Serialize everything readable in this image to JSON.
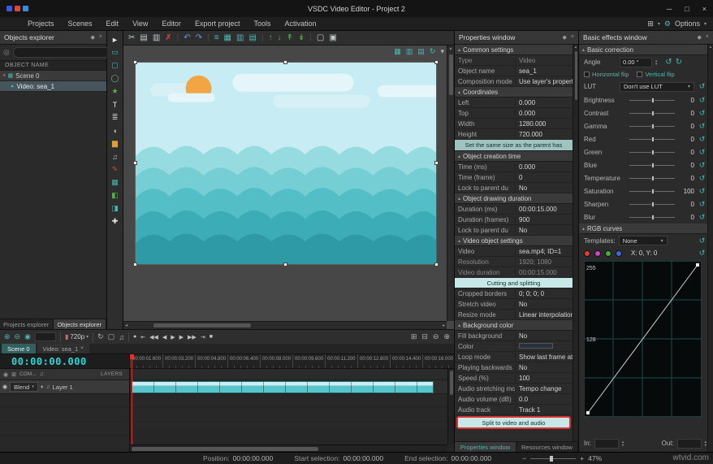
{
  "colors": {
    "accent": "#4db6b0",
    "timecode_cyan": "#2fd8d8",
    "annotation_red": "#e03030"
  },
  "icons": {
    "pin": "◆",
    "close": "×",
    "caret_up": "▴",
    "caret_down": "▾",
    "caret_right": "▸",
    "caret_left": "◂",
    "search": "◎",
    "eye": "◉",
    "lock": "⊠",
    "speaker": "♫",
    "diamond": "♦",
    "reset": "↺",
    "rotate_ccw": "↺",
    "rotate_cw": "↻",
    "menu": "≡",
    "window_min": "─",
    "window_max": "□",
    "grid": "⊞",
    "gear": "⚙",
    "minus": "−",
    "plus": "+",
    "quality_film": "▮"
  },
  "titlebar": {
    "title": "VSDC Video Editor - Project 2",
    "logo_colors": [
      "#3b5bd6",
      "#d64a3b",
      "#3b8bd6"
    ]
  },
  "menubar": {
    "items": [
      "Projects",
      "Scenes",
      "Edit",
      "View",
      "Editor",
      "Export project",
      "Tools",
      "Activation"
    ],
    "options": "Options"
  },
  "toolbar": {
    "icons": [
      {
        "name": "cut-icon",
        "glyph": "✂",
        "color": "#c2cccc"
      },
      {
        "name": "copy-icon",
        "glyph": "▤",
        "color": "#c2cccc"
      },
      {
        "name": "paste-icon",
        "glyph": "▥",
        "color": "#c2cccc"
      },
      {
        "name": "delete-icon",
        "glyph": "✗",
        "color": "#d24a43"
      },
      {
        "name": "separator",
        "glyph": "|",
        "color": "#4a4a4a"
      },
      {
        "name": "undo-icon",
        "glyph": "↶",
        "color": "#5f9fd8"
      },
      {
        "name": "redo-icon",
        "glyph": "↷",
        "color": "#5f9fd8"
      },
      {
        "name": "separator",
        "glyph": "|",
        "color": "#4a4a4a"
      },
      {
        "name": "align-list-icon",
        "glyph": "≡",
        "color": "#4db6b0"
      },
      {
        "name": "align-grid-icon",
        "glyph": "▦",
        "color": "#4db6b0"
      },
      {
        "name": "align-columns-icon",
        "glyph": "▥",
        "color": "#4db6b0"
      },
      {
        "name": "align-rows-icon",
        "glyph": "▤",
        "color": "#4db6b0"
      },
      {
        "name": "separator",
        "glyph": "|",
        "color": "#4a4a4a"
      },
      {
        "name": "move-up-icon",
        "glyph": "↑",
        "color": "#58b04e"
      },
      {
        "name": "move-down-icon",
        "glyph": "↓",
        "color": "#58b04e"
      },
      {
        "name": "move-top-icon",
        "glyph": "↟",
        "color": "#58b04e"
      },
      {
        "name": "move-bottom-icon",
        "glyph": "↡",
        "color": "#58b04e"
      },
      {
        "name": "separator",
        "glyph": "|",
        "color": "#4a4a4a"
      },
      {
        "name": "group-icon",
        "glyph": "▢",
        "color": "#c2cccc"
      },
      {
        "name": "ungroup-icon",
        "glyph": "▣",
        "color": "#c2cccc"
      }
    ]
  },
  "preview_corner": {
    "icons": [
      {
        "name": "grid-view-icon",
        "glyph": "▦",
        "color": "#4db6b0"
      },
      {
        "name": "split-view-icon",
        "glyph": "▥",
        "color": "#4db6b0"
      },
      {
        "name": "layout-view-icon",
        "glyph": "▤",
        "color": "#4db6b0"
      },
      {
        "name": "refresh-view-icon",
        "glyph": "↻",
        "color": "#4db6b0"
      },
      {
        "name": "view-menu-icon",
        "glyph": "▾",
        "color": "#b0b0b0"
      }
    ]
  },
  "tools": {
    "icons": [
      {
        "name": "cursor-tool-icon",
        "glyph": "►",
        "color": "#e8e8e8"
      },
      {
        "name": "select-tool-icon",
        "glyph": "▭",
        "color": "#4db6b0"
      },
      {
        "name": "rectangle-tool-icon",
        "glyph": "▢",
        "color": "#4db6b0"
      },
      {
        "name": "ellipse-tool-icon",
        "glyph": "◯",
        "color": "#4db6b0"
      },
      {
        "name": "star-tool-icon",
        "glyph": "★",
        "color": "#58b04e"
      },
      {
        "name": "text-tool-icon",
        "glyph": "T",
        "color": "#e8e8e8"
      },
      {
        "name": "lines-tool-icon",
        "glyph": "≣",
        "color": "#c0c0c0"
      },
      {
        "name": "tooltip-tool-icon",
        "glyph": "◖",
        "color": "#c0c0c0"
      },
      {
        "name": "chart-tool-icon",
        "glyph": "▆",
        "color": "#d8a13c"
      },
      {
        "name": "audio-tool-icon",
        "glyph": "♫",
        "color": "#c0c0c0"
      },
      {
        "name": "pencil-tool-icon",
        "glyph": "✎",
        "color": "#d24a43"
      },
      {
        "name": "sprite-tool-icon",
        "glyph": "▦",
        "color": "#4db6b0"
      },
      {
        "name": "animation-tool-icon",
        "glyph": "◧",
        "color": "#58b04e"
      },
      {
        "name": "gradient-tool-icon",
        "glyph": "◨",
        "color": "#4db6b0"
      },
      {
        "name": "movement-tool-icon",
        "glyph": "✚",
        "color": "#e8e8e8"
      }
    ]
  },
  "objects_explorer": {
    "title": "Objects explorer",
    "column_header": "OBJECT NAME",
    "scene_label": "Scene 0",
    "video_label": "Video: sea_1",
    "tabs": {
      "projects": "Projects explorer",
      "objects": "Objects explorer"
    }
  },
  "preview": {
    "canvas": {
      "sky": "#c8ecf3",
      "cloud": "#e4f6f9",
      "cloud2": "#d6f0f6",
      "sun": "#f2a643",
      "waves": [
        "#96dbdf",
        "#74ced4",
        "#54bec7",
        "#3cacb7",
        "#2d9aa6"
      ]
    }
  },
  "transport": {
    "left": [
      {
        "name": "add-object-icon",
        "glyph": "⊕",
        "color": "#4db6b0"
      },
      {
        "name": "remove-object-icon",
        "glyph": "⊖",
        "color": "#4db6b0"
      },
      {
        "name": "capture-icon",
        "glyph": "◉",
        "color": "#4db6b0"
      }
    ],
    "quality": "720p",
    "mid": [
      {
        "name": "loop-playback-icon",
        "glyph": "↻",
        "color": "#b0b0b0"
      },
      {
        "name": "preview-window-icon",
        "glyph": "▢",
        "color": "#b0b0b0"
      },
      {
        "name": "audio-mute-icon",
        "glyph": "♫",
        "color": "#b0b0b0"
      }
    ],
    "buttons": [
      {
        "name": "record-icon",
        "glyph": "●",
        "color": "#c0c0c0"
      },
      {
        "name": "go-start-icon",
        "glyph": "⇤",
        "color": "#c0c0c0"
      },
      {
        "name": "fast-backward-icon",
        "glyph": "◀◀",
        "color": "#c0c0c0"
      },
      {
        "name": "frame-back-icon",
        "glyph": "◀",
        "color": "#c0c0c0"
      },
      {
        "name": "play-icon",
        "glyph": "▶",
        "color": "#c0c0c0"
      },
      {
        "name": "frame-forward-icon",
        "glyph": "▶",
        "color": "#c0c0c0"
      },
      {
        "name": "fast-forward-icon",
        "glyph": "▶▶",
        "color": "#c0c0c0"
      },
      {
        "name": "go-end-icon",
        "glyph": "⇥",
        "color": "#c0c0c0"
      },
      {
        "name": "stop-icon",
        "glyph": "■",
        "color": "#c0c0c0"
      }
    ],
    "right": [
      {
        "name": "fit-timeline-icon",
        "glyph": "⊞",
        "color": "#b0b0b0"
      },
      {
        "name": "zoom-selection-icon",
        "glyph": "⊟",
        "color": "#b0b0b0"
      },
      {
        "name": "timeline-zoom-out-icon",
        "glyph": "⊖",
        "color": "#b0b0b0"
      },
      {
        "name": "timeline-zoom-in-icon",
        "glyph": "⊕",
        "color": "#b0b0b0"
      }
    ]
  },
  "scene_tabs": {
    "scene": "Scene 0",
    "video": "Video: sea_1"
  },
  "timeline": {
    "timecode": "00:00:00.000",
    "com_label": "COM...",
    "layers_label": "LAYERS",
    "blend_label": "Blend",
    "layer_label": "Layer 1",
    "ruler": [
      "00:00:01.600",
      "00:00:03.200",
      "00:00:04.800",
      "00:00:06.400",
      "00:00:08.000",
      "00:00:09.600",
      "00:00:11.200",
      "00:00:12.800",
      "00:00:14.400",
      "00:00:16.000"
    ]
  },
  "properties": {
    "title": "Properties window",
    "sections": {
      "common": {
        "header": "Common settings",
        "rows": [
          {
            "label": "Type",
            "value": "Video",
            "lcolor": "#8a8a8a",
            "vcolor": "#8a8a8a"
          },
          {
            "label": "Object name",
            "value": "sea_1"
          },
          {
            "label": "Composition mode",
            "value": "Use layer's properties"
          }
        ]
      },
      "coordinates": {
        "header": "Coordinates",
        "rows": [
          {
            "label": "Left",
            "value": "0.000"
          },
          {
            "label": "Top",
            "value": "0.000"
          },
          {
            "label": "Width",
            "value": "1280.000"
          },
          {
            "label": "Height",
            "value": "720.000"
          }
        ],
        "button": "Set the same size as the parent has"
      },
      "creation": {
        "header": "Object creation time",
        "rows": [
          {
            "label": "Time (ms)",
            "value": "0.000"
          },
          {
            "label": "Time (frame)",
            "value": "0"
          },
          {
            "label": "Lock to parent du",
            "value": "No"
          }
        ]
      },
      "drawing": {
        "header": "Object drawing duration",
        "rows": [
          {
            "label": "Duration (ms)",
            "value": "00:00:15.000"
          },
          {
            "label": "Duration (frames)",
            "value": "900"
          },
          {
            "label": "Lock to parent du",
            "value": "No"
          }
        ]
      },
      "video": {
        "header": "Video object settings",
        "rows": [
          {
            "label": "Video",
            "value": "sea.mp4; ID=1"
          },
          {
            "label": "Resolution",
            "value": "1920; 1080",
            "lcolor": "#8a8a8a",
            "vcolor": "#8a8a8a"
          },
          {
            "label": "Video duration",
            "value": "00:00:15.000",
            "lcolor": "#8a8a8a",
            "vcolor": "#8a8a8a"
          }
        ],
        "band": "Cutting and splitting",
        "rows2": [
          {
            "label": "Cropped borders",
            "value": "0; 0; 0; 0"
          },
          {
            "label": "Stretch video",
            "value": "No"
          },
          {
            "label": "Resize mode",
            "value": "Linear interpolation"
          }
        ]
      },
      "background": {
        "header": "Background color",
        "rows1": [
          {
            "label": "Fill background",
            "value": "No"
          }
        ],
        "color_row": {
          "label": "Color",
          "swatch": "#26313d"
        },
        "rows2": [
          {
            "label": "Loop mode",
            "value": "Show last frame at the"
          },
          {
            "label": "Playing backwards",
            "value": "No"
          },
          {
            "label": "Speed (%)",
            "value": "100"
          },
          {
            "label": "Audio stretching mo",
            "value": "Tempo change"
          },
          {
            "label": "Audio volume (dB)",
            "value": "0.0"
          },
          {
            "label": "Audio track",
            "value": "Track 1"
          }
        ],
        "split_button": "Split to video and audio"
      }
    },
    "tabs": {
      "properties": "Properties window",
      "resources": "Resources window"
    }
  },
  "effects": {
    "title": "Basic effects window",
    "correction": {
      "header": "Basic correction",
      "angle_label": "Angle",
      "angle_value": "0.00 °",
      "hflip": "Horizontal flip",
      "vflip": "Vertical flip",
      "lut_label": "LUT",
      "lut_value": "Don't use LUT",
      "sliders": [
        {
          "label": "Brightness",
          "value": "0"
        },
        {
          "label": "Contrast",
          "value": "0"
        },
        {
          "label": "Gamma",
          "value": "0"
        },
        {
          "label": "Red",
          "value": "0"
        },
        {
          "label": "Green",
          "value": "0"
        },
        {
          "label": "Blue",
          "value": "0"
        },
        {
          "label": "Temperature",
          "value": "0"
        },
        {
          "label": "Saturation",
          "value": "100"
        },
        {
          "label": "Sharpen",
          "value": "0"
        },
        {
          "label": "Blur",
          "value": "0"
        }
      ]
    },
    "curves": {
      "header": "RGB curves",
      "templates_label": "Templates:",
      "templates_value": "None",
      "dot_colors": [
        "#e23b3b",
        "#cc44cc",
        "#3bb23b",
        "#4466dd"
      ],
      "coords": "X: 0, Y: 0",
      "y_max": "255",
      "y_mid": "128",
      "in_label": "In:",
      "in_value": "",
      "out_label": "Out:",
      "out_value": ""
    }
  },
  "statusbar": {
    "groups": [
      {
        "label": "Position:",
        "value": "00:00:00.000"
      },
      {
        "label": "Start selection:",
        "value": "00:00:00.000"
      },
      {
        "label": "End selection:",
        "value": "00:00:00.000"
      }
    ],
    "zoom": "47%"
  },
  "watermark": "wtvid.com"
}
